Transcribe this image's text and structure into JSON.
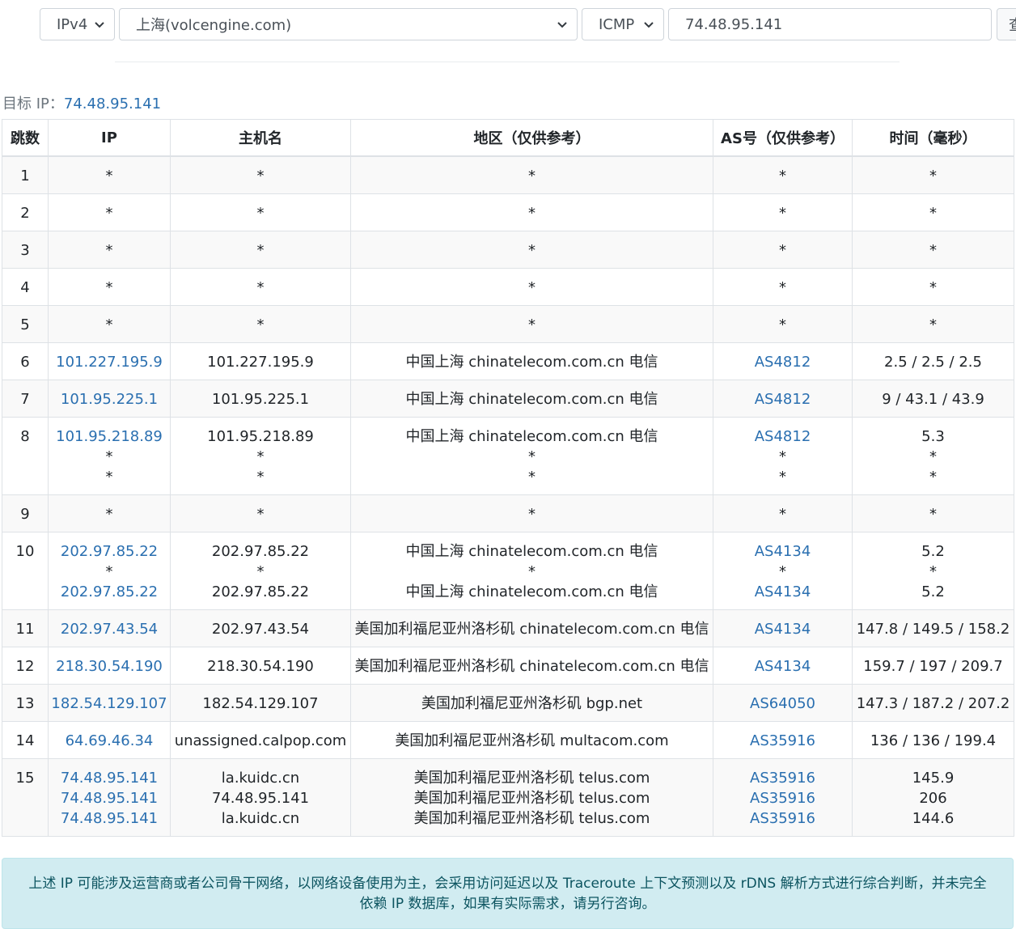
{
  "form": {
    "ip_version": "IPv4",
    "node": "上海(volcengine.com)",
    "protocol": "ICMP",
    "target_value": "74.48.95.141",
    "submit_label": "查"
  },
  "target": {
    "label": "目标 IP：",
    "ip": "74.48.95.141"
  },
  "table": {
    "headers": [
      "跳数",
      "IP",
      "主机名",
      "地区（仅供参考）",
      "AS号（仅供参考）",
      "时间（毫秒）"
    ],
    "rows": [
      {
        "hop": "1",
        "ips": [
          "*"
        ],
        "hosts": [
          "*"
        ],
        "regions": [
          "*"
        ],
        "asns": [
          "*"
        ],
        "times": [
          "*"
        ]
      },
      {
        "hop": "2",
        "ips": [
          "*"
        ],
        "hosts": [
          "*"
        ],
        "regions": [
          "*"
        ],
        "asns": [
          "*"
        ],
        "times": [
          "*"
        ]
      },
      {
        "hop": "3",
        "ips": [
          "*"
        ],
        "hosts": [
          "*"
        ],
        "regions": [
          "*"
        ],
        "asns": [
          "*"
        ],
        "times": [
          "*"
        ]
      },
      {
        "hop": "4",
        "ips": [
          "*"
        ],
        "hosts": [
          "*"
        ],
        "regions": [
          "*"
        ],
        "asns": [
          "*"
        ],
        "times": [
          "*"
        ]
      },
      {
        "hop": "5",
        "ips": [
          "*"
        ],
        "hosts": [
          "*"
        ],
        "regions": [
          "*"
        ],
        "asns": [
          "*"
        ],
        "times": [
          "*"
        ]
      },
      {
        "hop": "6",
        "ips": [
          "101.227.195.9"
        ],
        "hosts": [
          "101.227.195.9"
        ],
        "regions": [
          "中国上海 chinatelecom.com.cn 电信"
        ],
        "asns": [
          "AS4812"
        ],
        "times": [
          "2.5 / 2.5 / 2.5"
        ]
      },
      {
        "hop": "7",
        "ips": [
          "101.95.225.1"
        ],
        "hosts": [
          "101.95.225.1"
        ],
        "regions": [
          "中国上海 chinatelecom.com.cn 电信"
        ],
        "asns": [
          "AS4812"
        ],
        "times": [
          "9 / 43.1 / 43.9"
        ]
      },
      {
        "hop": "8",
        "ips": [
          "101.95.218.89",
          "*",
          "*"
        ],
        "hosts": [
          "101.95.218.89",
          "*",
          "*"
        ],
        "regions": [
          "中国上海 chinatelecom.com.cn 电信",
          "*",
          "*"
        ],
        "asns": [
          "AS4812",
          "*",
          "*"
        ],
        "times": [
          "5.3",
          "*",
          "*"
        ]
      },
      {
        "hop": "9",
        "ips": [
          "*"
        ],
        "hosts": [
          "*"
        ],
        "regions": [
          "*"
        ],
        "asns": [
          "*"
        ],
        "times": [
          "*"
        ]
      },
      {
        "hop": "10",
        "ips": [
          "202.97.85.22",
          "*",
          "202.97.85.22"
        ],
        "hosts": [
          "202.97.85.22",
          "*",
          "202.97.85.22"
        ],
        "regions": [
          "中国上海 chinatelecom.com.cn 电信",
          "*",
          "中国上海 chinatelecom.com.cn 电信"
        ],
        "asns": [
          "AS4134",
          "*",
          "AS4134"
        ],
        "times": [
          "5.2",
          "*",
          "5.2"
        ]
      },
      {
        "hop": "11",
        "ips": [
          "202.97.43.54"
        ],
        "hosts": [
          "202.97.43.54"
        ],
        "regions": [
          "美国加利福尼亚州洛杉矶 chinatelecom.com.cn 电信"
        ],
        "asns": [
          "AS4134"
        ],
        "times": [
          "147.8 / 149.5 / 158.2"
        ]
      },
      {
        "hop": "12",
        "ips": [
          "218.30.54.190"
        ],
        "hosts": [
          "218.30.54.190"
        ],
        "regions": [
          "美国加利福尼亚州洛杉矶 chinatelecom.com.cn 电信"
        ],
        "asns": [
          "AS4134"
        ],
        "times": [
          "159.7 / 197 / 209.7"
        ]
      },
      {
        "hop": "13",
        "ips": [
          "182.54.129.107"
        ],
        "hosts": [
          "182.54.129.107"
        ],
        "regions": [
          "美国加利福尼亚州洛杉矶 bgp.net"
        ],
        "asns": [
          "AS64050"
        ],
        "times": [
          "147.3 / 187.2 / 207.2"
        ]
      },
      {
        "hop": "14",
        "ips": [
          "64.69.46.34"
        ],
        "hosts": [
          "unassigned.calpop.com"
        ],
        "regions": [
          "美国加利福尼亚州洛杉矶 multacom.com"
        ],
        "asns": [
          "AS35916"
        ],
        "times": [
          "136 / 136 / 199.4"
        ]
      },
      {
        "hop": "15",
        "ips": [
          "74.48.95.141",
          "74.48.95.141",
          "74.48.95.141"
        ],
        "hosts": [
          "la.kuidc.cn",
          "74.48.95.141",
          "la.kuidc.cn"
        ],
        "regions": [
          "美国加利福尼亚州洛杉矶 telus.com",
          "美国加利福尼亚州洛杉矶 telus.com",
          "美国加利福尼亚州洛杉矶 telus.com"
        ],
        "asns": [
          "AS35916",
          "AS35916",
          "AS35916"
        ],
        "times": [
          "145.9",
          "206",
          "144.6"
        ]
      }
    ]
  },
  "notice": "上述 IP 可能涉及运营商或者公司骨干网络，以网络设备使用为主，会采用访问延迟以及 Traceroute 上下文预测以及 rDNS 解析方式进行综合判断，并未完全依赖 IP 数据库，如果有实际需求，请另行咨询。"
}
